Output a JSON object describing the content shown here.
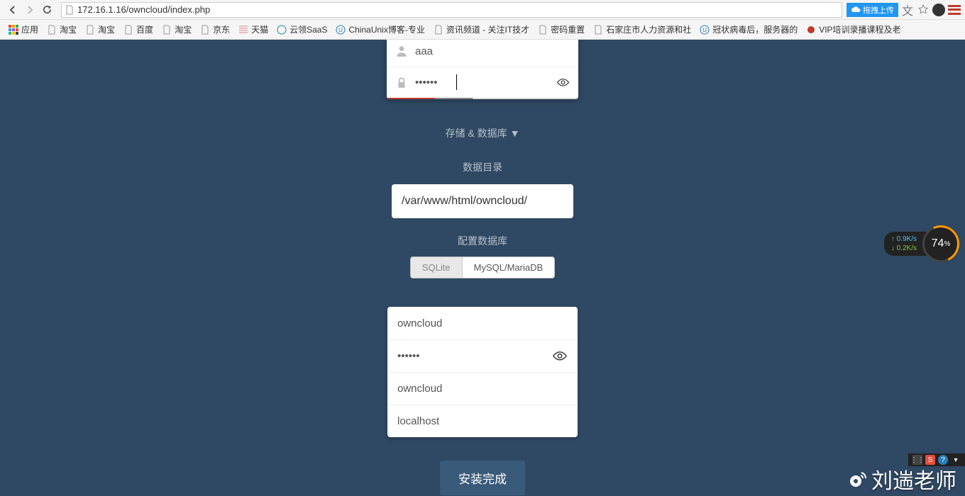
{
  "browser": {
    "url": "172.16.1.16/owncloud/index.php",
    "upload_badge": "拖拽上传"
  },
  "bookmarks": {
    "apps": "应用",
    "items": [
      "淘宝",
      "淘宝",
      "百度",
      "淘宝",
      "京东",
      "天猫",
      "云领SaaS",
      "ChinaUnix博客-专业",
      "资讯频道 - 关注IT技才",
      "密码重置",
      "石家庄市人力资源和社",
      "冠状病毒后，服务器的",
      "VIP培训录播课程及老"
    ]
  },
  "admin": {
    "username": "aaa",
    "password": "••••••"
  },
  "storage_toggle": "存储 & 数据库 ▼",
  "data_dir_label": "数据目录",
  "data_dir_value": "/var/www/html/owncloud/",
  "db_label": "配置数据库",
  "db_options": {
    "sqlite": "SQLite",
    "mysql": "MySQL/MariaDB"
  },
  "db_form": {
    "user": "owncloud",
    "pass": "••••••",
    "name": "owncloud",
    "host": "localhost"
  },
  "submit": "安装完成",
  "net": {
    "up": "0.9K/s",
    "down": "0.2K/s",
    "pct": "74",
    "pct_suffix": "%"
  },
  "watermark": "刘遄老师"
}
